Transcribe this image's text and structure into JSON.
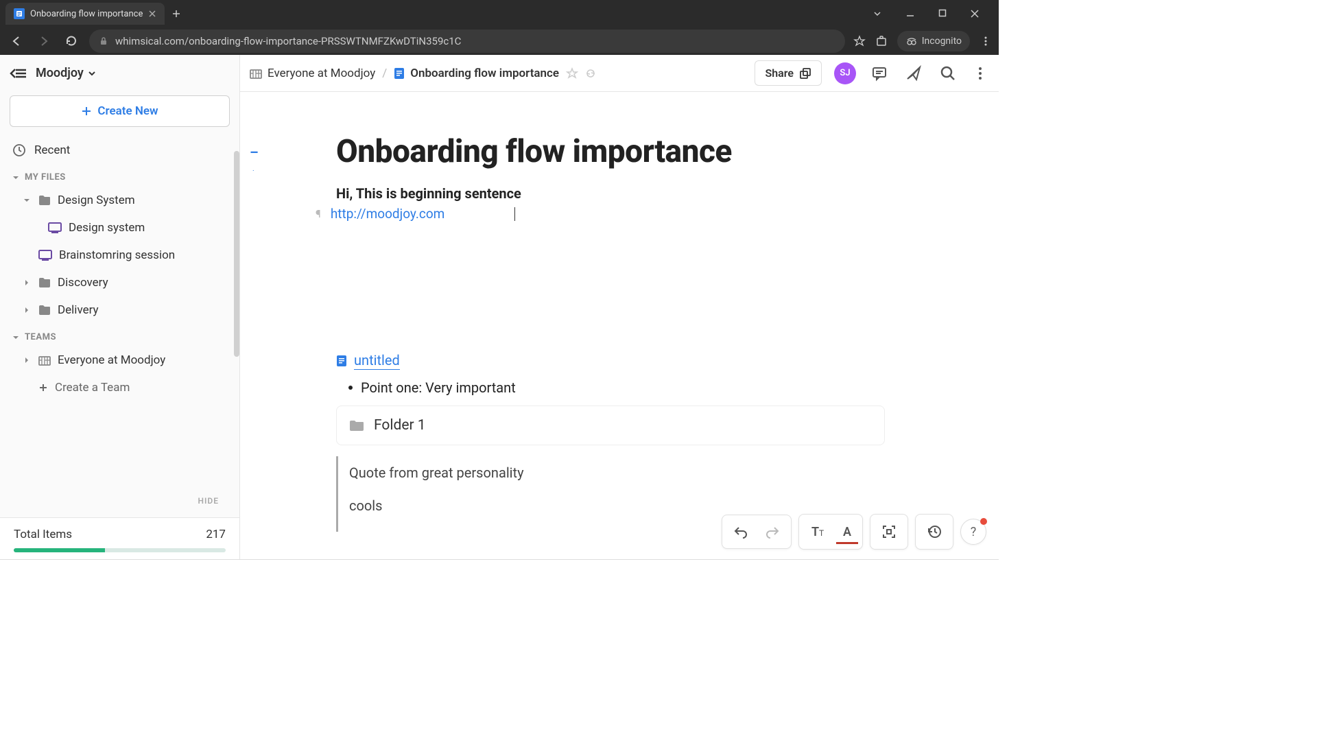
{
  "browser": {
    "tab_title": "Onboarding flow importance",
    "url": "whimsical.com/onboarding-flow-importance-PRSSWTNMFZKwDTiN359c1C",
    "incognito_label": "Incognito"
  },
  "sidebar": {
    "workspace_name": "Moodjoy",
    "create_label": "Create New",
    "recent_label": "Recent",
    "section_my_files": "MY FILES",
    "section_teams": "TEAMS",
    "hide_label": "HIDE",
    "files": [
      {
        "label": "Design System"
      },
      {
        "label": "Design system"
      },
      {
        "label": "Brainstomring session"
      },
      {
        "label": "Discovery"
      },
      {
        "label": "Delivery"
      }
    ],
    "teams": [
      {
        "label": "Everyone at Moodjoy"
      },
      {
        "label": "Create a Team"
      }
    ],
    "stats_label": "Total Items",
    "stats_value": "217"
  },
  "topbar": {
    "bc_team": "Everyone at Moodjoy",
    "bc_doc": "Onboarding flow importance",
    "share_label": "Share",
    "avatar_initials": "SJ"
  },
  "document": {
    "title": "Onboarding flow importance",
    "heading": "Hi, This is beginning sentence",
    "link_text": "http://moodjoy.com",
    "embed_title": "untitled",
    "bullet_1": "Point one: Very important",
    "folder_label": "Folder 1",
    "quote_line1": "Quote from great personality",
    "quote_line2": "cools"
  }
}
